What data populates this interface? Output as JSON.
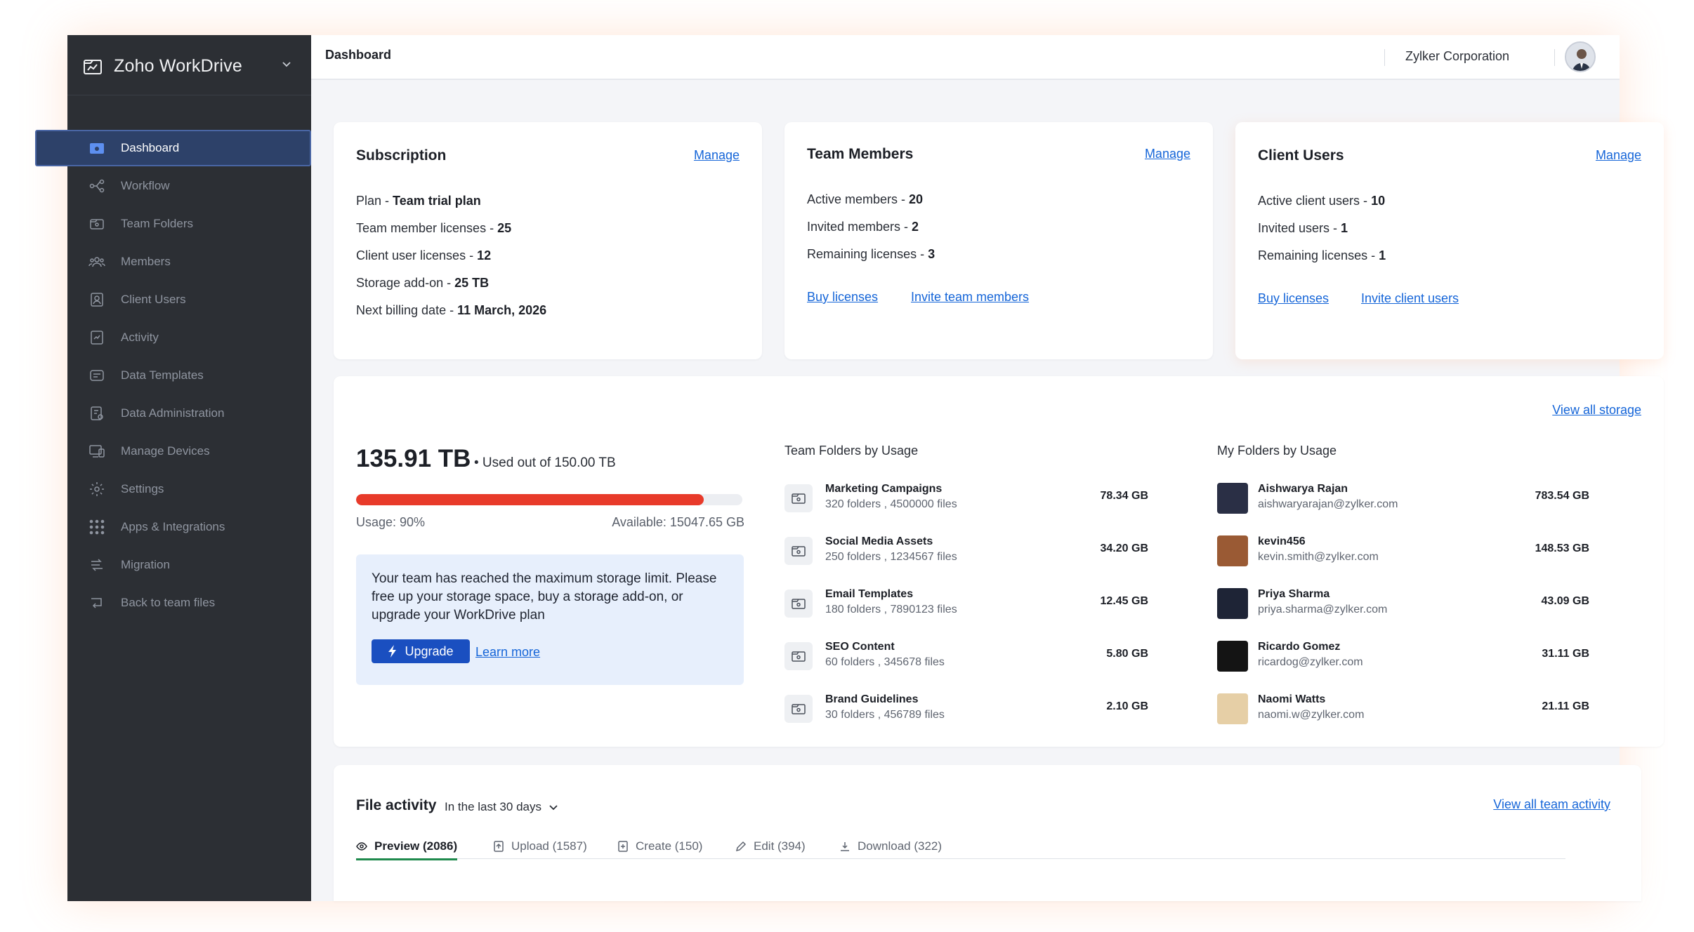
{
  "app": {
    "name": "Zoho WorkDrive"
  },
  "sidebar": {
    "items": [
      {
        "label": "Dashboard",
        "icon": "dashboard-folder-icon",
        "active": true
      },
      {
        "label": "Workflow",
        "icon": "workflow-icon"
      },
      {
        "label": "Team Folders",
        "icon": "team-folder-icon"
      },
      {
        "label": "Members",
        "icon": "members-icon"
      },
      {
        "label": "Client Users",
        "icon": "client-users-icon"
      },
      {
        "label": "Activity",
        "icon": "activity-icon"
      },
      {
        "label": "Data Templates",
        "icon": "data-templates-icon"
      },
      {
        "label": "Data Administration",
        "icon": "data-administration-icon"
      },
      {
        "label": "Manage Devices",
        "icon": "devices-icon"
      },
      {
        "label": "Settings",
        "icon": "gear-icon"
      },
      {
        "label": "Apps & Integrations",
        "icon": "apps-grid-icon"
      },
      {
        "label": "Migration",
        "icon": "migration-icon"
      },
      {
        "label": "Back to team files",
        "icon": "back-arrow-icon"
      }
    ]
  },
  "header": {
    "title": "Dashboard",
    "org": "Zylker Corporation"
  },
  "subscription": {
    "title": "Subscription",
    "manage": "Manage",
    "rows": [
      {
        "label": "Plan - ",
        "value": "Team trial plan"
      },
      {
        "label": "Team member licenses - ",
        "value": "25"
      },
      {
        "label": "Client user licenses - ",
        "value": "12"
      },
      {
        "label": "Storage add-on - ",
        "value": "25 TB"
      },
      {
        "label": "Next billing date - ",
        "value": "11 March, 2026"
      }
    ]
  },
  "team_members": {
    "title": "Team Members",
    "manage": "Manage",
    "rows": [
      {
        "label": "Active members - ",
        "value": "20"
      },
      {
        "label": "Invited members - ",
        "value": "2"
      },
      {
        "label": "Remaining licenses - ",
        "value": "3"
      }
    ],
    "buy": "Buy licenses",
    "invite": "Invite team members"
  },
  "client_users": {
    "title": "Client Users",
    "manage": "Manage",
    "rows": [
      {
        "label": "Active client users - ",
        "value": "10"
      },
      {
        "label": "Invited users - ",
        "value": "1"
      },
      {
        "label": "Remaining licenses - ",
        "value": "1"
      }
    ],
    "buy": "Buy licenses",
    "invite": "Invite client users"
  },
  "storage": {
    "view_all": "View all storage",
    "used": "135.91 TB",
    "used_of": "• Used out of 150.00 TB",
    "usage_fraction": 0.9,
    "usage_label": "Usage: 90%",
    "available": "Available: 15047.65 GB",
    "alert": "Your team has reached the maximum storage limit. Please free up your storage space, buy a storage add-on, or upgrade your WorkDrive plan",
    "upgrade": "Upgrade",
    "learn_more": "Learn more",
    "team_folders_title": "Team Folders by Usage",
    "team_folders": [
      {
        "name": "Marketing Campaigns",
        "sub": "320 folders , 4500000 files",
        "size": "78.34 GB"
      },
      {
        "name": "Social Media Assets",
        "sub": "250 folders , 1234567 files",
        "size": "34.20 GB"
      },
      {
        "name": "Email Templates",
        "sub": "180 folders , 7890123 files",
        "size": "12.45 GB"
      },
      {
        "name": "SEO Content",
        "sub": "60 folders , 345678 files",
        "size": "5.80 GB"
      },
      {
        "name": "Brand Guidelines",
        "sub": "30 folders , 456789 files",
        "size": "2.10 GB"
      }
    ],
    "my_folders_title": "My Folders by Usage",
    "my_folders": [
      {
        "name": "Aishwarya Rajan",
        "sub": "aishwaryarajan@zylker.com",
        "size": "783.54 GB",
        "color": "#2a2f45"
      },
      {
        "name": "kevin456",
        "sub": "kevin.smith@zylker.com",
        "size": "148.53 GB",
        "color": "#9a5a34"
      },
      {
        "name": "Priya Sharma",
        "sub": "priya.sharma@zylker.com",
        "size": "43.09 GB",
        "color": "#1e2436"
      },
      {
        "name": "Ricardo Gomez",
        "sub": "ricardog@zylker.com",
        "size": "31.11 GB",
        "color": "#141414"
      },
      {
        "name": "Naomi Watts",
        "sub": "naomi.w@zylker.com",
        "size": "21.11 GB",
        "color": "#e6cfa6"
      }
    ]
  },
  "file_activity": {
    "title": "File activity",
    "range": "In the last 30 days",
    "view_all": "View all team activity",
    "tabs": [
      {
        "label": "Preview (2086)",
        "icon": "eye-icon",
        "active": true
      },
      {
        "label": "Upload (1587)",
        "icon": "upload-icon"
      },
      {
        "label": "Create (150)",
        "icon": "create-icon"
      },
      {
        "label": "Edit (394)",
        "icon": "pencil-icon"
      },
      {
        "label": "Download (322)",
        "icon": "download-icon"
      }
    ]
  }
}
